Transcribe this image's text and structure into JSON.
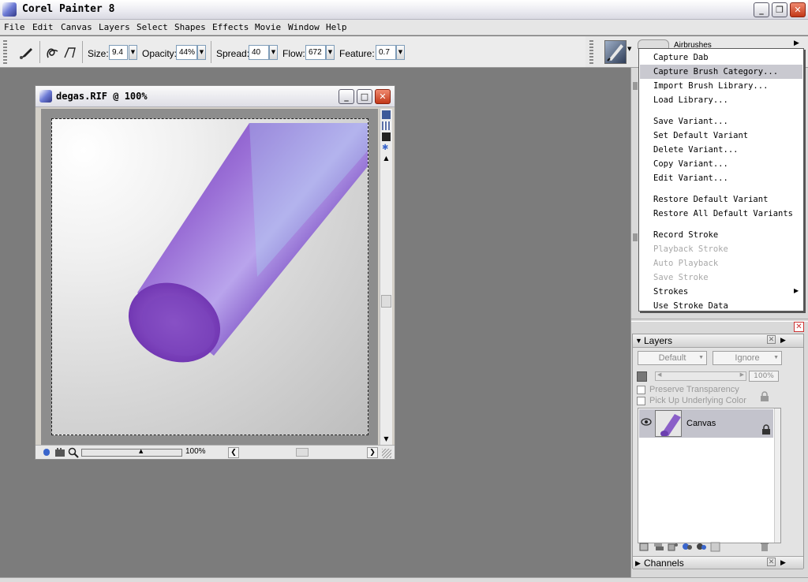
{
  "app": {
    "title": "Corel Painter 8"
  },
  "menubar": {
    "items": [
      "File",
      "Edit",
      "Canvas",
      "Layers",
      "Select",
      "Shapes",
      "Effects",
      "Movie",
      "Window",
      "Help"
    ]
  },
  "propbar": {
    "size_label": "Size:",
    "size_value": "9.4",
    "opacity_label": "Opacity:",
    "opacity_value": "44%",
    "spread_label": "Spread:",
    "spread_value": "40",
    "flow_label": "Flow:",
    "flow_value": "672",
    "feature_label": "Feature:",
    "feature_value": "0.7"
  },
  "brush_selector": {
    "category_label": "Airbrushes"
  },
  "document": {
    "title": "degas.RIF @ 100%",
    "zoom": "100%"
  },
  "context_menu": {
    "items": [
      {
        "label": "Capture Dab",
        "enabled": true
      },
      {
        "label": "Capture Brush Category...",
        "enabled": true,
        "highlighted": true
      },
      {
        "label": "Import Brush Library...",
        "enabled": true
      },
      {
        "label": "Load Library...",
        "enabled": true
      },
      {
        "label": "Save Variant...",
        "enabled": true
      },
      {
        "label": "Set Default Variant",
        "enabled": true
      },
      {
        "label": "Delete Variant...",
        "enabled": true
      },
      {
        "label": "Copy Variant...",
        "enabled": true
      },
      {
        "label": "Edit Variant...",
        "enabled": true
      },
      {
        "label": "Restore Default Variant",
        "enabled": true
      },
      {
        "label": "Restore All Default Variants",
        "enabled": true
      },
      {
        "label": "Record Stroke",
        "enabled": true
      },
      {
        "label": "Playback Stroke",
        "enabled": false
      },
      {
        "label": "Auto Playback",
        "enabled": false
      },
      {
        "label": "Save Stroke",
        "enabled": false
      },
      {
        "label": "Strokes",
        "enabled": true,
        "submenu": true
      },
      {
        "label": "Use Stroke Data",
        "enabled": true
      }
    ]
  },
  "layers_panel": {
    "title": "Layers",
    "composite_method": "Default",
    "composite_depth": "Ignore",
    "opacity": "100%",
    "preserve_transparency_label": "Preserve Transparency",
    "pick_up_color_label": "Pick Up Underlying Color",
    "layers": [
      {
        "name": "Canvas",
        "visible": true,
        "locked": true
      }
    ]
  },
  "channels_panel": {
    "title": "Channels"
  },
  "colors": {
    "accent_purple": "#8a5fc8",
    "highlight": "#c9c9d0",
    "close_red": "#c23818"
  }
}
